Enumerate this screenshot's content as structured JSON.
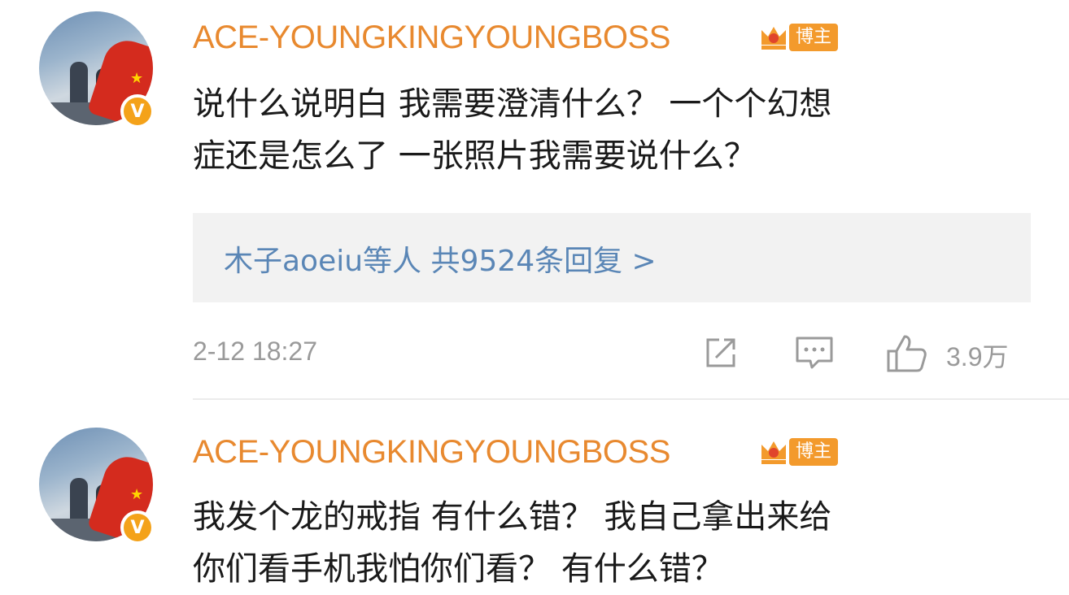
{
  "comments": [
    {
      "username": "ACE-YOUNGKINGYOUNGBOSS",
      "role_badge": "博主",
      "verified_mark": "V",
      "text_line1": "说什么说明白 我需要澄清什么？ 一个个幻想",
      "text_line2": "症还是怎么了 一张照片我需要说什么？",
      "replies_summary": "木子aoeiu等人 共9524条回复 >",
      "timestamp": "2-12 18:27",
      "likes": "3.9万",
      "icons": [
        "share-icon",
        "comment-icon",
        "like-icon"
      ]
    },
    {
      "username": "ACE-YOUNGKINGYOUNGBOSS",
      "role_badge": "博主",
      "verified_mark": "V",
      "text_line1": "我发个龙的戒指 有什么错？ 我自己拿出来给",
      "text_line2": "你们看手机我怕你们看？ 有什么错？"
    }
  ],
  "colors": {
    "username": "#e8892f",
    "badge": "#f39a2c",
    "link": "#5a86b6",
    "meta": "#9a9a9a"
  }
}
